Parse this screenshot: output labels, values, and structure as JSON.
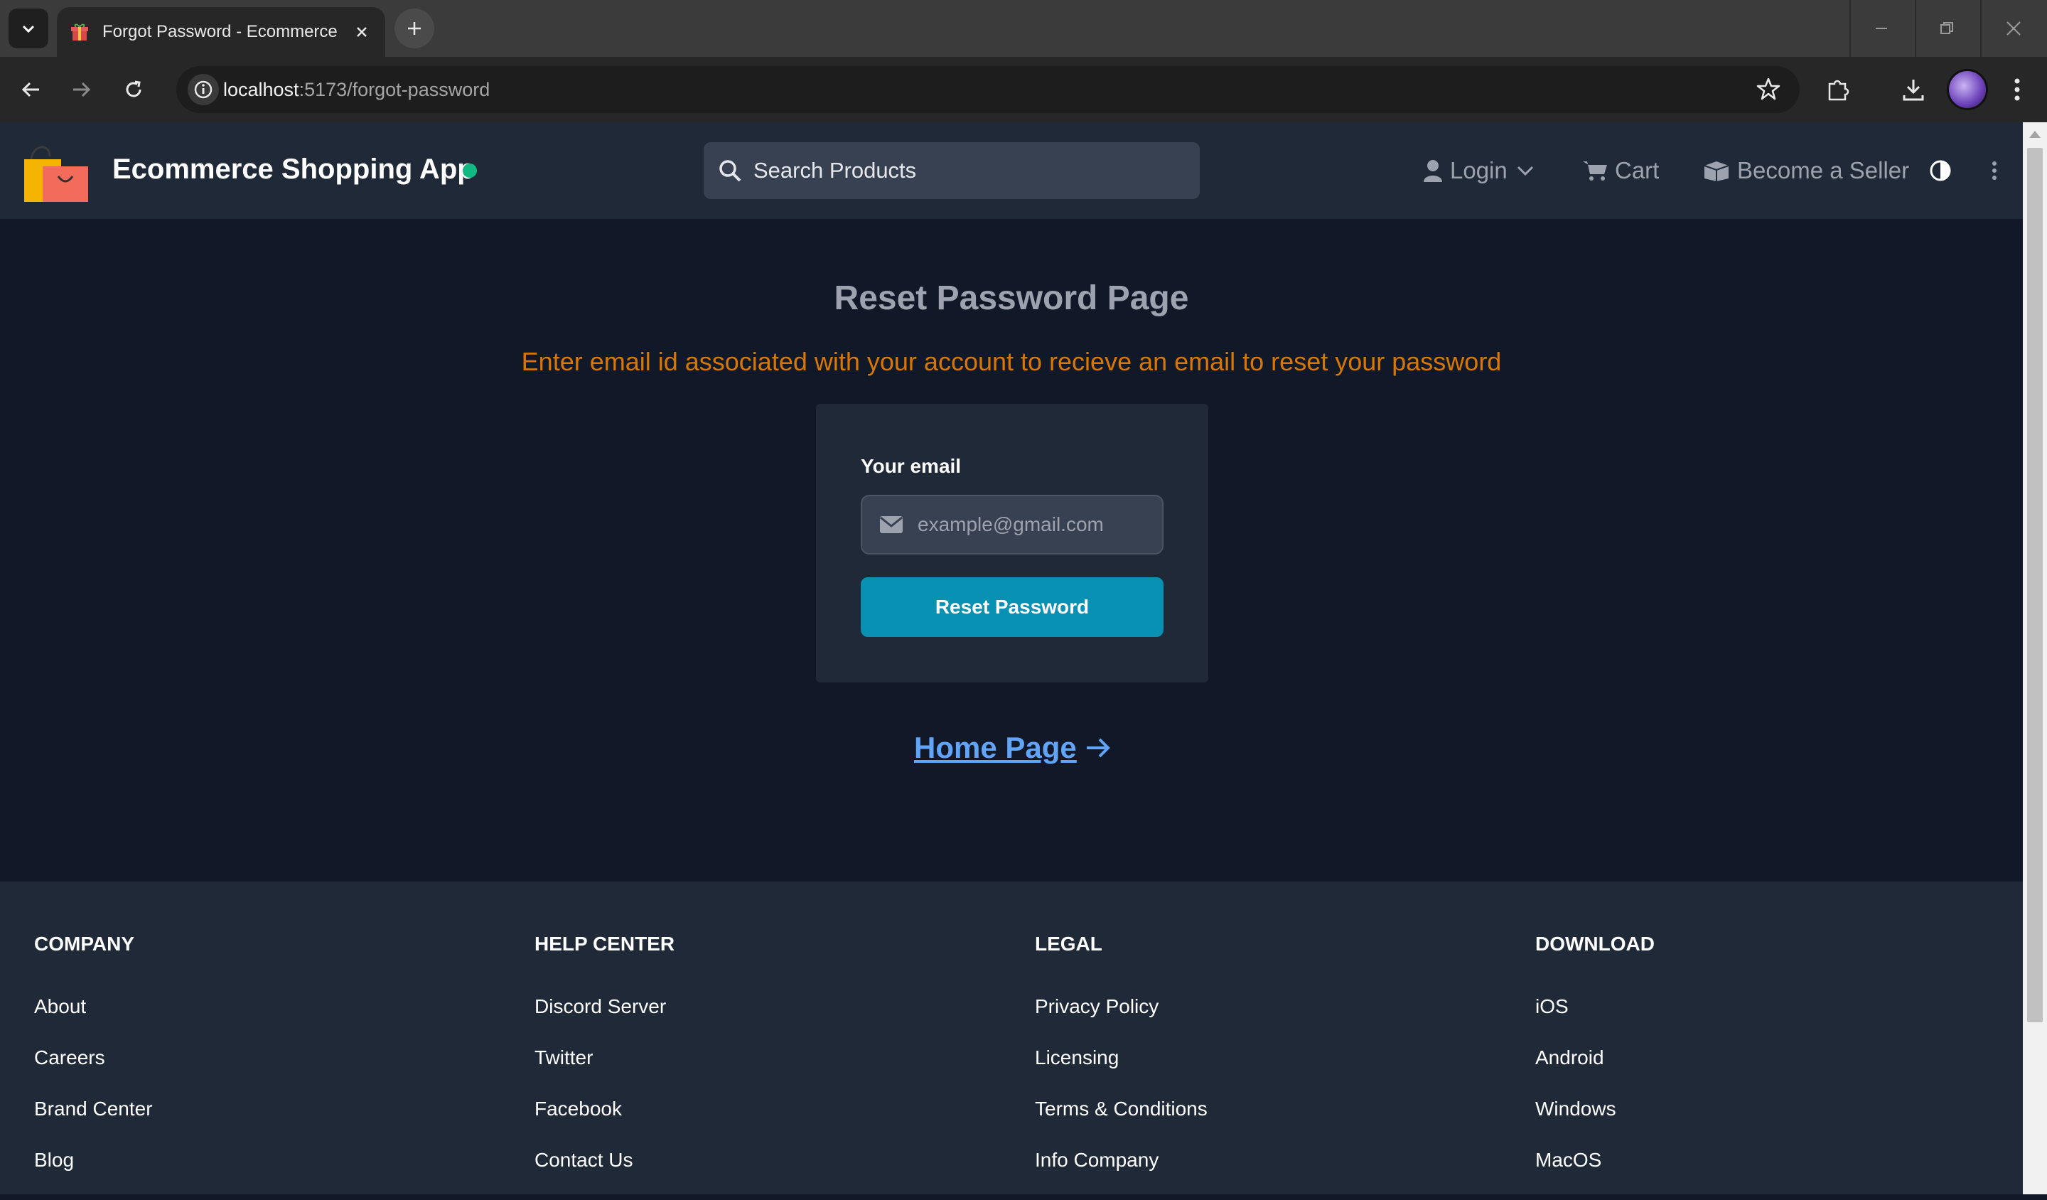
{
  "browser": {
    "tab_title": "Forgot Password - Ecommerce Shopping App",
    "url_host": "localhost",
    "url_path": ":5173/forgot-password"
  },
  "navbar": {
    "brand": "Ecommerce Shopping App",
    "search_placeholder": "Search Products",
    "login_label": "Login",
    "cart_label": "Cart",
    "seller_label": "Become a Seller"
  },
  "main": {
    "title": "Reset Password Page",
    "subtitle": "Enter email id associated with your account to recieve an email to reset your password",
    "email_label": "Your email",
    "email_placeholder": "example@gmail.com",
    "email_value": "",
    "reset_button": "Reset Password",
    "home_link": "Home Page"
  },
  "footer": {
    "columns": [
      {
        "title": "Company",
        "links": [
          "About",
          "Careers",
          "Brand Center",
          "Blog"
        ]
      },
      {
        "title": "Help center",
        "links": [
          "Discord Server",
          "Twitter",
          "Facebook",
          "Contact Us"
        ]
      },
      {
        "title": "Legal",
        "links": [
          "Privacy Policy",
          "Licensing",
          "Terms & Conditions",
          "Info Company"
        ]
      },
      {
        "title": "Download",
        "links": [
          "iOS",
          "Android",
          "Windows",
          "MacOS"
        ]
      }
    ]
  },
  "colors": {
    "page_bg": "#111827",
    "navbar_bg": "#1f2937",
    "accent_button": "#0891b2",
    "subtitle_orange": "#d97706",
    "link_blue": "#60a5fa",
    "status_dot": "#10b981"
  }
}
